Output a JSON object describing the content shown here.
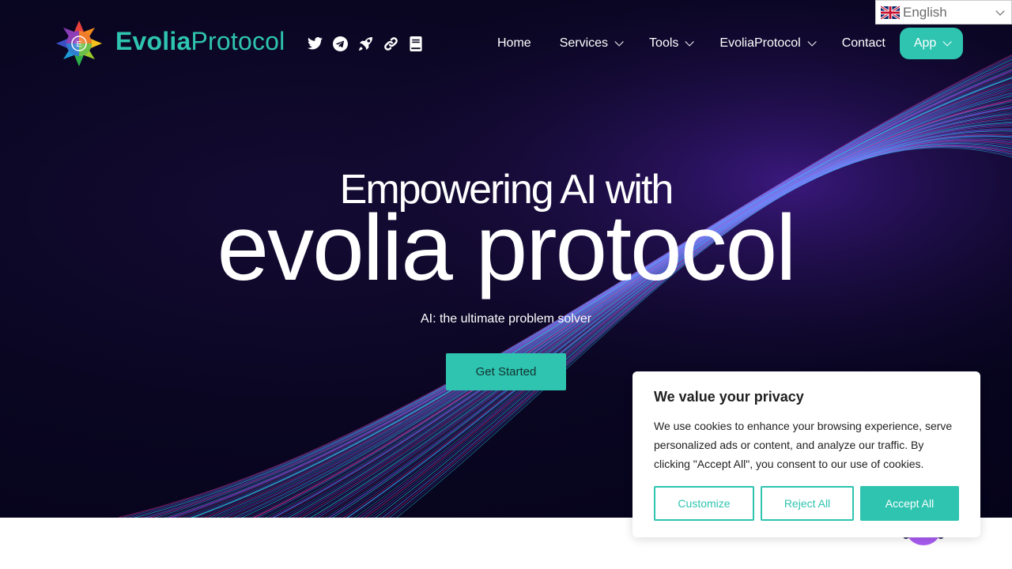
{
  "header": {
    "brand_bold": "Evolia",
    "brand_light": "Protocol",
    "socials": [
      {
        "name": "twitter-icon"
      },
      {
        "name": "telegram-icon"
      },
      {
        "name": "rocket-icon"
      },
      {
        "name": "link-icon"
      },
      {
        "name": "book-icon"
      }
    ],
    "nav": [
      {
        "label": "Home",
        "dropdown": false
      },
      {
        "label": "Services",
        "dropdown": true
      },
      {
        "label": "Tools",
        "dropdown": true
      },
      {
        "label": "EvoliaProtocol",
        "dropdown": true
      },
      {
        "label": "Contact",
        "dropdown": false
      },
      {
        "label": "App",
        "dropdown": true
      }
    ]
  },
  "language": {
    "selected": "English",
    "flag": "uk-flag-icon"
  },
  "hero": {
    "subtitle": "Empowering AI with",
    "title": "evolia protocol",
    "tagline": "AI: the ultimate problem solver",
    "cta": "Get Started"
  },
  "cookie": {
    "title": "We value your privacy",
    "message": "We use cookies to enhance your browsing experience, serve personalized ads or content, and analyze our traffic. By clicking \"Accept All\", you consent to our use of cookies.",
    "customize": "Customize",
    "reject": "Reject All",
    "accept": "Accept All"
  },
  "colors": {
    "accent": "#2ec4b0",
    "hero_bg": "#0a0622"
  }
}
